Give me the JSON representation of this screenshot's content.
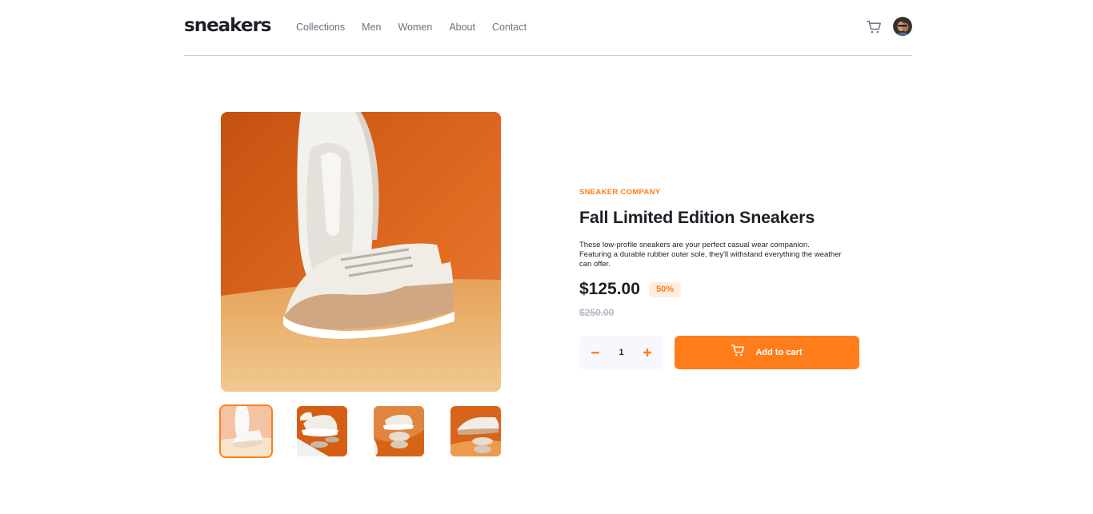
{
  "header": {
    "logo": "sneakers",
    "nav": [
      "Collections",
      "Men",
      "Women",
      "About",
      "Contact"
    ]
  },
  "icons": {
    "cart": "cart-icon",
    "avatar": "user-avatar",
    "minus": "minus-icon",
    "plus": "plus-icon"
  },
  "product": {
    "company": "SNEAKER COMPANY",
    "title": "Fall Limited Edition Sneakers",
    "description": "These low-profile sneakers are your perfect casual wear companion. Featuring a durable rubber outer sole, they'll withstand everything the weather can offer.",
    "price": "$125.00",
    "discount": "50%",
    "old_price": "$250.00",
    "quantity": "1",
    "add_to_cart": "Add to cart"
  },
  "colors": {
    "accent": "#ff7e1b",
    "accent_light": "#ffede0",
    "text_dark": "#1d2026",
    "text_muted": "#69707d",
    "strike": "#b6bcc8",
    "qty_bg": "#f6f8fd"
  }
}
